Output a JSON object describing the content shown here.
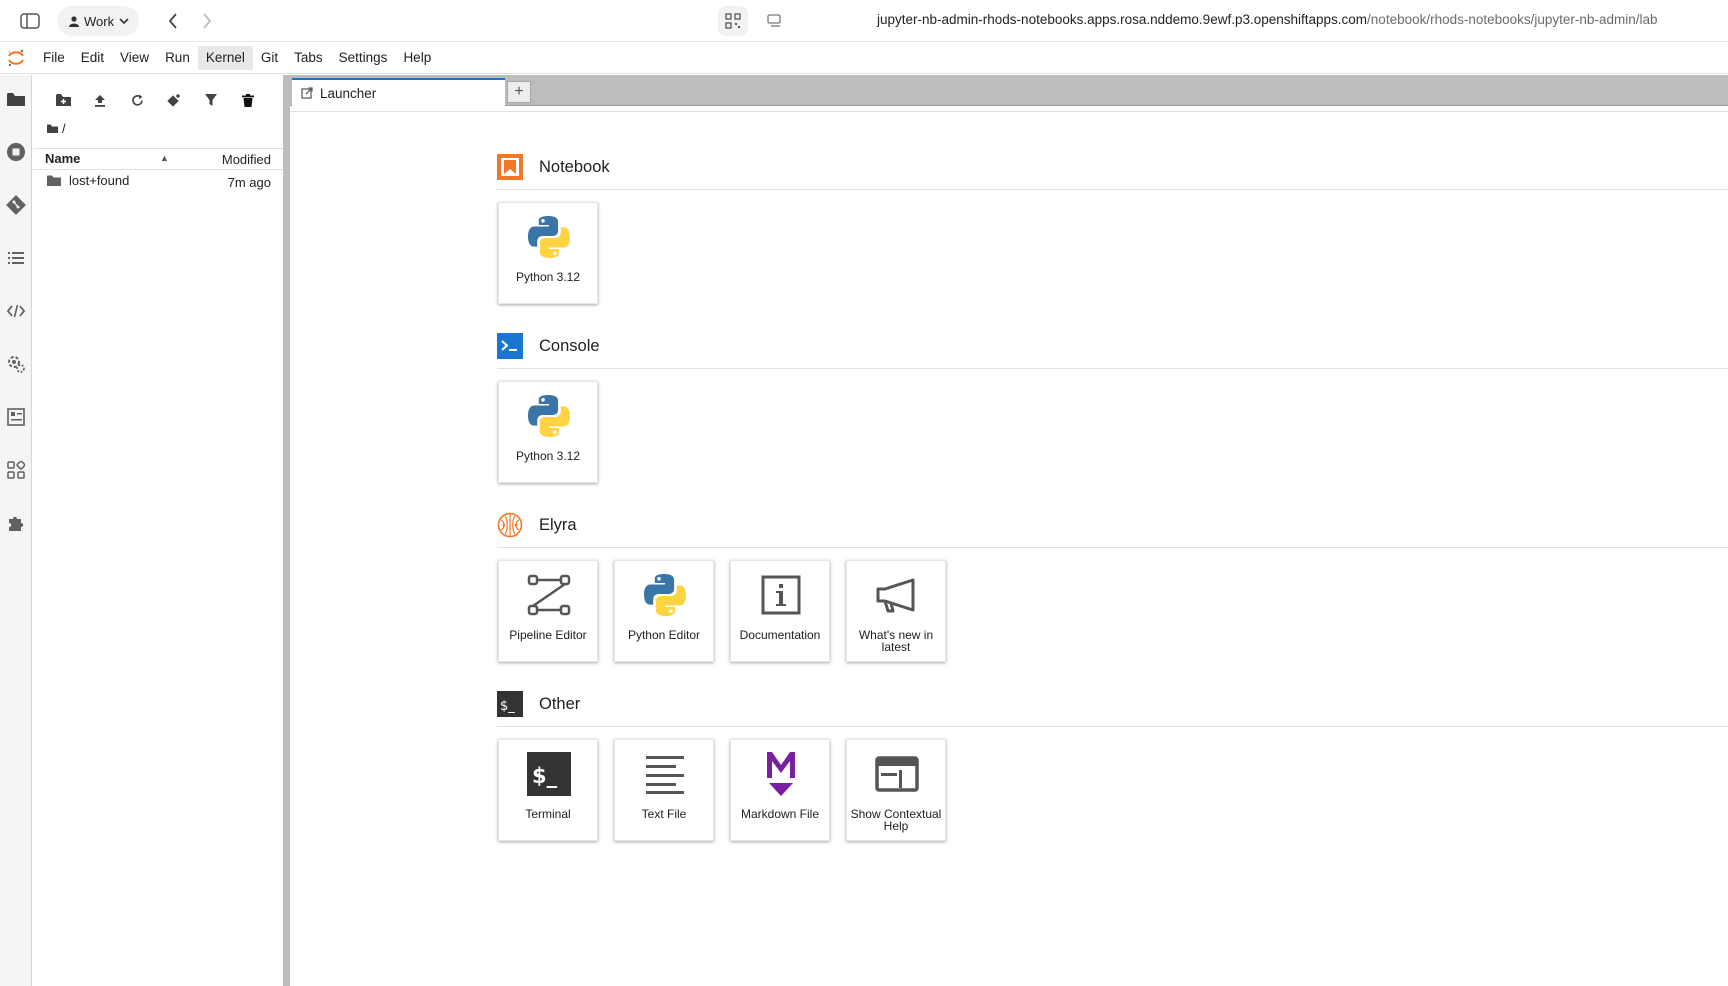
{
  "browser": {
    "profile_label": "Work",
    "url_host": "jupyter-nb-admin-rhods-notebooks.apps.rosa.nddemo.9ewf.p3.openshiftapps.com",
    "url_path": "/notebook/rhods-notebooks/jupyter-nb-admin/lab"
  },
  "menubar": {
    "items": [
      "File",
      "Edit",
      "View",
      "Run",
      "Kernel",
      "Git",
      "Tabs",
      "Settings",
      "Help"
    ],
    "active": "Kernel"
  },
  "filebrowser": {
    "breadcrumb": "/",
    "columns": {
      "name": "Name",
      "modified": "Modified"
    },
    "rows": [
      {
        "name": "lost+found",
        "modified": "7m ago"
      }
    ]
  },
  "tabs": [
    {
      "label": "Launcher",
      "icon": "launcher-icon"
    }
  ],
  "add_tab_label": "+",
  "launcher": {
    "sections": [
      {
        "title": "Notebook",
        "icon": "notebook-section-icon",
        "cards": [
          {
            "label": "Python 3.12",
            "icon": "python-logo-icon"
          }
        ]
      },
      {
        "title": "Console",
        "icon": "console-section-icon",
        "cards": [
          {
            "label": "Python 3.12",
            "icon": "python-logo-icon"
          }
        ]
      },
      {
        "title": "Elyra",
        "icon": "elyra-section-icon",
        "cards": [
          {
            "label": "Pipeline Editor",
            "icon": "pipeline-icon"
          },
          {
            "label": "Python Editor",
            "icon": "python-logo-icon"
          },
          {
            "label": "Documentation",
            "icon": "info-icon"
          },
          {
            "label": "What's new in latest",
            "icon": "megaphone-icon"
          }
        ]
      },
      {
        "title": "Other",
        "icon": "other-section-icon",
        "cards": [
          {
            "label": "Terminal",
            "icon": "terminal-icon"
          },
          {
            "label": "Text File",
            "icon": "text-file-icon"
          },
          {
            "label": "Markdown File",
            "icon": "markdown-icon"
          },
          {
            "label": "Show Contextual Help",
            "icon": "contextual-help-icon"
          }
        ]
      }
    ]
  },
  "colors": {
    "accent": "#1976d2",
    "notebook_orange": "#f37726",
    "markdown_purple": "#7b1fa2",
    "terminal_dark": "#333333"
  }
}
